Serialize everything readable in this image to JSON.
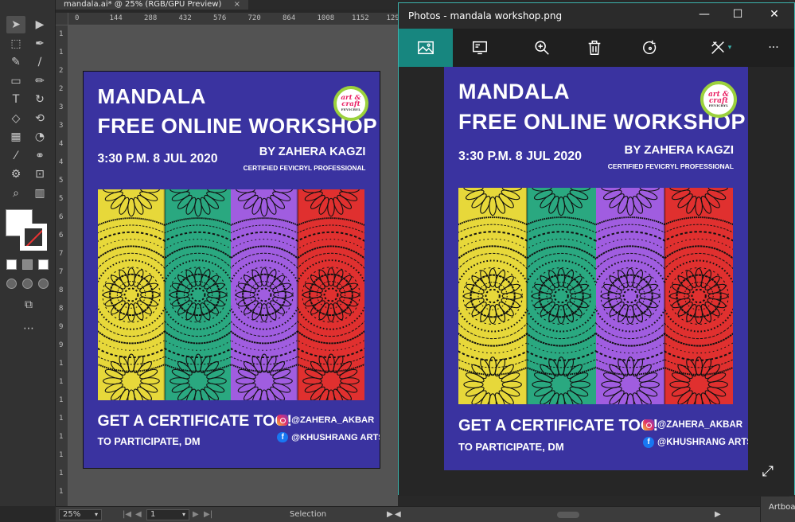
{
  "illustrator": {
    "tab_title": "mandala.ai* @ 25% (RGB/GPU Preview)",
    "tab_close": "×",
    "ruler_h": [
      "0",
      "144",
      "288",
      "432",
      "576",
      "720",
      "864",
      "1008",
      "1152",
      "129"
    ],
    "ruler_v": [
      "1",
      "1",
      "2",
      "2",
      "3",
      "3",
      "4",
      "4",
      "5",
      "5",
      "6",
      "6",
      "7",
      "7",
      "8",
      "8",
      "9",
      "9",
      "1",
      "1",
      "1",
      "1",
      "1",
      "1",
      "1",
      "1"
    ],
    "tools": [
      "selection-tool",
      "direct-selection-tool",
      "artboard-tool",
      "pen-tool",
      "curvature-tool",
      "brush-tool",
      "rectangle-tool",
      "pencil-tool",
      "type-tool",
      "rotate-tool",
      "eraser-tool",
      "lasso-tool",
      "gradient-tool",
      "shape-builder-tool",
      "eyedropper-tool",
      "blend-tool",
      "symbol-tool",
      "crop-tool",
      "zoom-tool",
      "graph-tool"
    ],
    "status": {
      "zoom": "25%",
      "artboard": "1",
      "mode": "Selection",
      "panel_tab": "Artboa"
    }
  },
  "photos": {
    "window_title": "Photos - mandala workshop.png",
    "controls": {
      "minimize": "—",
      "maximize": "☐",
      "close": "✕"
    },
    "toolbar": [
      "view-photo",
      "slideshow",
      "zoom",
      "delete",
      "rotate",
      "edit"
    ],
    "more_label": "···"
  },
  "flyer": {
    "title_line1": "MANDALA",
    "title_line2": "FREE ONLINE WORKSHOP",
    "date": "3:30 P.M. 8 JUL 2020",
    "by": "BY ZAHERA KAGZI",
    "cert": "CERTIFIED FEVICRYL PROFESSIONAL",
    "cta": "GET A CERTIFICATE TOO!",
    "participate": "TO PARTICIPATE, DM",
    "instagram": "@ZAHERA_AKBAR",
    "facebook": "@KHUSHRANG ARTS",
    "logo_line1": "art &",
    "logo_line2": "craft",
    "logo_small": "FEVICRYL",
    "strip_colors": [
      "#e7d83a",
      "#2aa880",
      "#a05de0",
      "#e0302f"
    ],
    "background": "#3a33a0"
  }
}
